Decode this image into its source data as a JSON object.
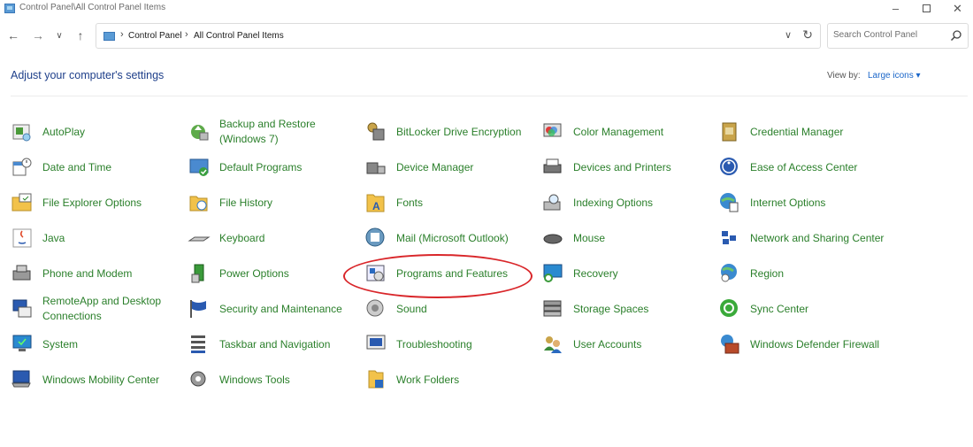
{
  "window": {
    "title": "Control Panel\\All Control Panel Items"
  },
  "nav": {
    "crumbs": [
      "Control Panel",
      "All Control Panel Items"
    ],
    "search_placeholder": "Search Control Panel"
  },
  "header": {
    "title": "Adjust your computer's settings",
    "view_by_label": "View by:",
    "view_by_value": "Large icons ▾"
  },
  "items": [
    {
      "label": "AutoPlay",
      "icon": "autoplay-icon"
    },
    {
      "label": "Backup and Restore (Windows 7)",
      "icon": "backup-icon"
    },
    {
      "label": "BitLocker Drive Encryption",
      "icon": "bitlocker-icon"
    },
    {
      "label": "Color Management",
      "icon": "color-management-icon"
    },
    {
      "label": "Credential Manager",
      "icon": "credential-manager-icon"
    },
    {
      "label": "Date and Time",
      "icon": "date-time-icon"
    },
    {
      "label": "Default Programs",
      "icon": "default-programs-icon"
    },
    {
      "label": "Device Manager",
      "icon": "device-manager-icon"
    },
    {
      "label": "Devices and Printers",
      "icon": "printer-icon"
    },
    {
      "label": "Ease of Access Center",
      "icon": "ease-of-access-icon"
    },
    {
      "label": "File Explorer Options",
      "icon": "folder-options-icon"
    },
    {
      "label": "File History",
      "icon": "file-history-icon"
    },
    {
      "label": "Fonts",
      "icon": "fonts-icon"
    },
    {
      "label": "Indexing Options",
      "icon": "indexing-icon"
    },
    {
      "label": "Internet Options",
      "icon": "internet-options-icon"
    },
    {
      "label": "Java",
      "icon": "java-icon"
    },
    {
      "label": "Keyboard",
      "icon": "keyboard-icon"
    },
    {
      "label": "Mail (Microsoft Outlook)",
      "icon": "mail-icon"
    },
    {
      "label": "Mouse",
      "icon": "mouse-icon"
    },
    {
      "label": "Network and Sharing Center",
      "icon": "network-icon"
    },
    {
      "label": "Phone and Modem",
      "icon": "phone-icon"
    },
    {
      "label": "Power Options",
      "icon": "power-icon"
    },
    {
      "label": "Programs and Features",
      "icon": "programs-icon"
    },
    {
      "label": "Recovery",
      "icon": "recovery-icon"
    },
    {
      "label": "Region",
      "icon": "region-icon"
    },
    {
      "label": "RemoteApp and Desktop Connections",
      "icon": "remoteapp-icon"
    },
    {
      "label": "Security and Maintenance",
      "icon": "flag-icon"
    },
    {
      "label": "Sound",
      "icon": "sound-icon"
    },
    {
      "label": "Storage Spaces",
      "icon": "storage-icon"
    },
    {
      "label": "Sync Center",
      "icon": "sync-icon"
    },
    {
      "label": "System",
      "icon": "system-icon"
    },
    {
      "label": "Taskbar and Navigation",
      "icon": "taskbar-icon"
    },
    {
      "label": "Troubleshooting",
      "icon": "troubleshooting-icon"
    },
    {
      "label": "User Accounts",
      "icon": "user-accounts-icon"
    },
    {
      "label": "Windows Defender Firewall",
      "icon": "firewall-icon"
    },
    {
      "label": "Windows Mobility Center",
      "icon": "mobility-icon"
    },
    {
      "label": "Windows Tools",
      "icon": "tools-icon"
    },
    {
      "label": "Work Folders",
      "icon": "work-folders-icon"
    }
  ],
  "highlighted_item": "Programs and Features",
  "colors": {
    "link": "#2a7f2a",
    "title": "#1e3f8a",
    "accent": "#1a66c9",
    "annotation": "#d9262a"
  }
}
